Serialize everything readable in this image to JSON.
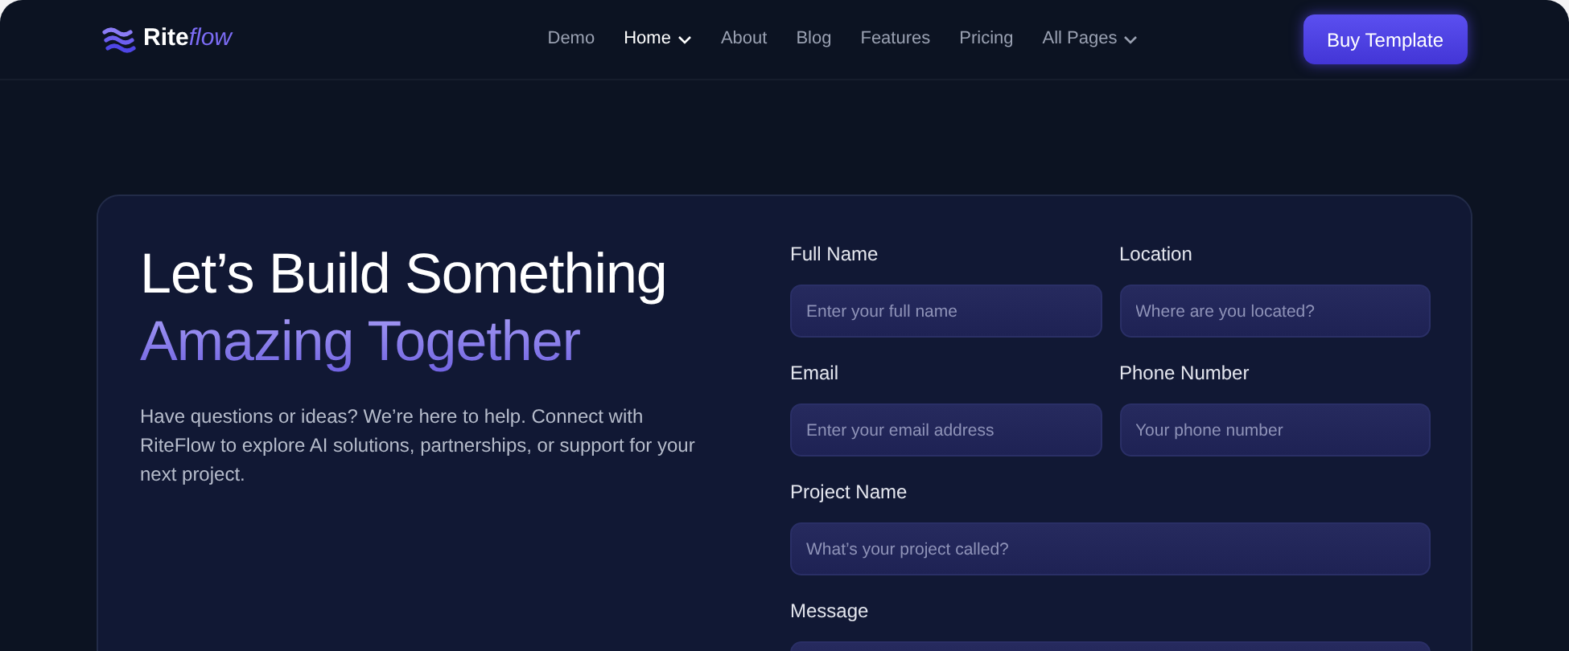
{
  "logo": {
    "parts": [
      "Rite",
      "flow"
    ]
  },
  "nav": [
    {
      "label": "Demo",
      "selected": false,
      "has_menu": false
    },
    {
      "label": "Home",
      "selected": true,
      "has_menu": true
    },
    {
      "label": "About",
      "selected": false,
      "has_menu": false
    },
    {
      "label": "Blog",
      "selected": false,
      "has_menu": false
    },
    {
      "label": "Features",
      "selected": false,
      "has_menu": false
    },
    {
      "label": "Pricing",
      "selected": false,
      "has_menu": false
    },
    {
      "label": "All Pages",
      "selected": false,
      "has_menu": true
    }
  ],
  "cta_button": "Buy Template",
  "heading": {
    "line_1": "Let’s Build Something",
    "line_2": "Amazing Together"
  },
  "intro": "Have questions or ideas? We’re here to help. Connect with RiteFlow to explore AI solutions, partnerships, or support for your next project.",
  "form": {
    "fields": [
      {
        "label": "Full Name",
        "placeholder": "Enter your full name",
        "wide": false
      },
      {
        "label": "Location",
        "placeholder": "Where are you located?",
        "wide": false
      },
      {
        "label": "Email",
        "placeholder": "Enter your email address",
        "wide": false
      },
      {
        "label": "Phone Number",
        "placeholder": "Your phone number",
        "wide": false
      },
      {
        "label": "Project Name",
        "placeholder": "What’s your project called?",
        "wide": true
      },
      {
        "label": "Message",
        "wide": true
      }
    ]
  }
}
